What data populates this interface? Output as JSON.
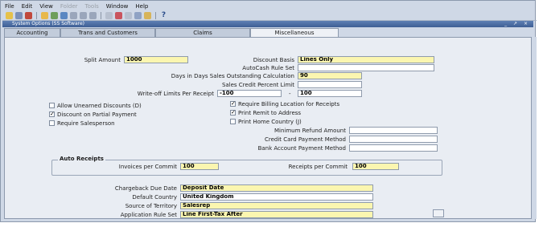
{
  "menu": {
    "file": "File",
    "edit": "Edit",
    "view": "View",
    "folder": "Folder",
    "tools": "Tools",
    "window": "Window",
    "help": "Help"
  },
  "window": {
    "title": "System Options (SS Software)",
    "controls": "_ ↗ ×"
  },
  "tabs": [
    "Accounting",
    "Trans and Customers",
    "Claims",
    "Miscellaneous"
  ],
  "form": {
    "split_amount": {
      "label": "Split Amount",
      "value": "1000"
    },
    "discount_basis": {
      "label": "Discount Basis",
      "value": "Lines Only"
    },
    "autocash_rule_set": {
      "label": "AutoCash Rule Set",
      "value": ""
    },
    "days_sales_outstanding": {
      "label": "Days in Days Sales Outstanding Calculation",
      "value": "90"
    },
    "sales_credit_percent_limit": {
      "label": "Sales Credit Percent Limit",
      "value": ""
    },
    "writeoff_limits": {
      "label": "Write-off Limits Per Receipt",
      "from": "-100",
      "dash": "-",
      "to": "100"
    },
    "allow_unearned_discounts": {
      "label": "Allow Unearned Discounts (D)",
      "checked": false
    },
    "discount_partial_payment": {
      "label": "Discount on Partial Payment",
      "checked": true
    },
    "require_salesperson": {
      "label": "Require Salesperson",
      "checked": false
    },
    "require_billing_location": {
      "label": "Require Billing Location for Receipts",
      "checked": true
    },
    "print_remit_address": {
      "label": "Print Remit to Address",
      "checked": true
    },
    "print_home_country": {
      "label": "Print Home Country (J)",
      "checked": false
    },
    "minimum_refund_amount": {
      "label": "Minimum Refund Amount",
      "value": ""
    },
    "credit_card_payment_method": {
      "label": "Credit Card Payment Method",
      "value": ""
    },
    "bank_account_payment_method": {
      "label": "Bank Account Payment Method",
      "value": ""
    },
    "auto_receipts": {
      "title": "Auto Receipts",
      "invoices_per_commit": {
        "label": "Invoices per Commit",
        "value": "100"
      },
      "receipts_per_commit": {
        "label": "Receipts per Commit",
        "value": "100"
      }
    },
    "chargeback_due_date": {
      "label": "Chargeback Due Date",
      "value": "Deposit Date"
    },
    "default_country": {
      "label": "Default Country",
      "value": "United Kingdom"
    },
    "source_of_territory": {
      "label": "Source of Territory",
      "value": "Salesrep"
    },
    "application_rule_set": {
      "label": "Application Rule Set",
      "value": "Line First-Tax After"
    }
  },
  "colors": {
    "required_field": "#fbf6b0",
    "panel": "#e9edf3",
    "titlebar": "#3f5f95"
  },
  "icons": [
    "save-icon",
    "print-icon",
    "close-form-icon",
    "find-icon",
    "zoom-icon",
    "navigate-icon",
    "cut-icon",
    "copy-icon",
    "paste-icon",
    "clear-icon",
    "delete-icon",
    "edit-icon",
    "attachment-icon",
    "folder-icon",
    "help-icon"
  ]
}
